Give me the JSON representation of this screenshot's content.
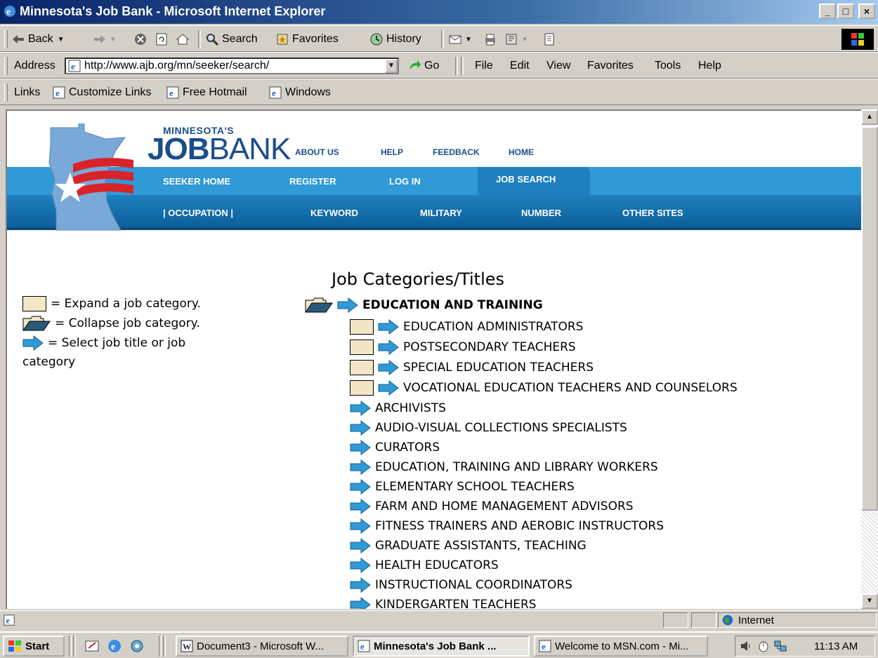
{
  "window": {
    "title": "Minnesota's Job Bank - Microsoft Internet Explorer",
    "controls": [
      "_",
      "□",
      "×"
    ]
  },
  "toolbar": {
    "back": "Back",
    "search": "Search",
    "favorites": "Favorites",
    "history": "History"
  },
  "addressbar": {
    "label": "Address",
    "url": "http://www.ajb.org/mn/seeker/search/",
    "go": "Go",
    "menus": [
      "File",
      "Edit",
      "View",
      "Favorites",
      "Tools",
      "Help"
    ]
  },
  "links": {
    "label": "Links",
    "items": [
      "Customize Links",
      "Free Hotmail",
      "Windows"
    ]
  },
  "site": {
    "brand_small": "MINNESOTA'S",
    "brand_job": "JOB",
    "brand_bank": "BANK",
    "top_links": [
      "ABOUT US",
      "HELP",
      "FEEDBACK",
      "HOME"
    ],
    "nav1": [
      "SEEKER HOME",
      "REGISTER",
      "LOG IN",
      "JOB SEARCH"
    ],
    "nav2": [
      "| OCCUPATION |",
      "KEYWORD",
      "MILITARY",
      "NUMBER",
      "OTHER SITES"
    ],
    "colors": {
      "primary": "#1a4e8c",
      "nav_light": "#2f9ad6",
      "nav_dark": "#1f7fbf",
      "flag_red": "#d8232a"
    }
  },
  "page": {
    "heading": "Job Categories/Titles",
    "legend": {
      "expand": "= Expand a job category.",
      "collapse": "= Collapse job category.",
      "select": "= Select job title or job",
      "select2": "category"
    },
    "top_category": "EDUCATION AND TRAINING",
    "subcategories": [
      "EDUCATION ADMINISTRATORS",
      "POSTSECONDARY TEACHERS",
      "SPECIAL EDUCATION TEACHERS",
      "VOCATIONAL EDUCATION TEACHERS AND COUNSELORS"
    ],
    "titles": [
      "ARCHIVISTS",
      "AUDIO-VISUAL COLLECTIONS SPECIALISTS",
      "CURATORS",
      "EDUCATION, TRAINING AND LIBRARY WORKERS",
      "ELEMENTARY SCHOOL TEACHERS",
      "FARM AND HOME MANAGEMENT ADVISORS",
      "FITNESS TRAINERS AND AEROBIC INSTRUCTORS",
      "GRADUATE ASSISTANTS, TEACHING",
      "HEALTH EDUCATORS",
      "INSTRUCTIONAL COORDINATORS",
      "KINDERGARTEN TEACHERS"
    ]
  },
  "statusbar": {
    "zone": "Internet"
  },
  "taskbar": {
    "start": "Start",
    "items": [
      "Document3 - Microsoft W...",
      "Minnesota's Job Bank ...",
      "Welcome to MSN.com - Mi..."
    ],
    "time": "11:13 AM"
  }
}
